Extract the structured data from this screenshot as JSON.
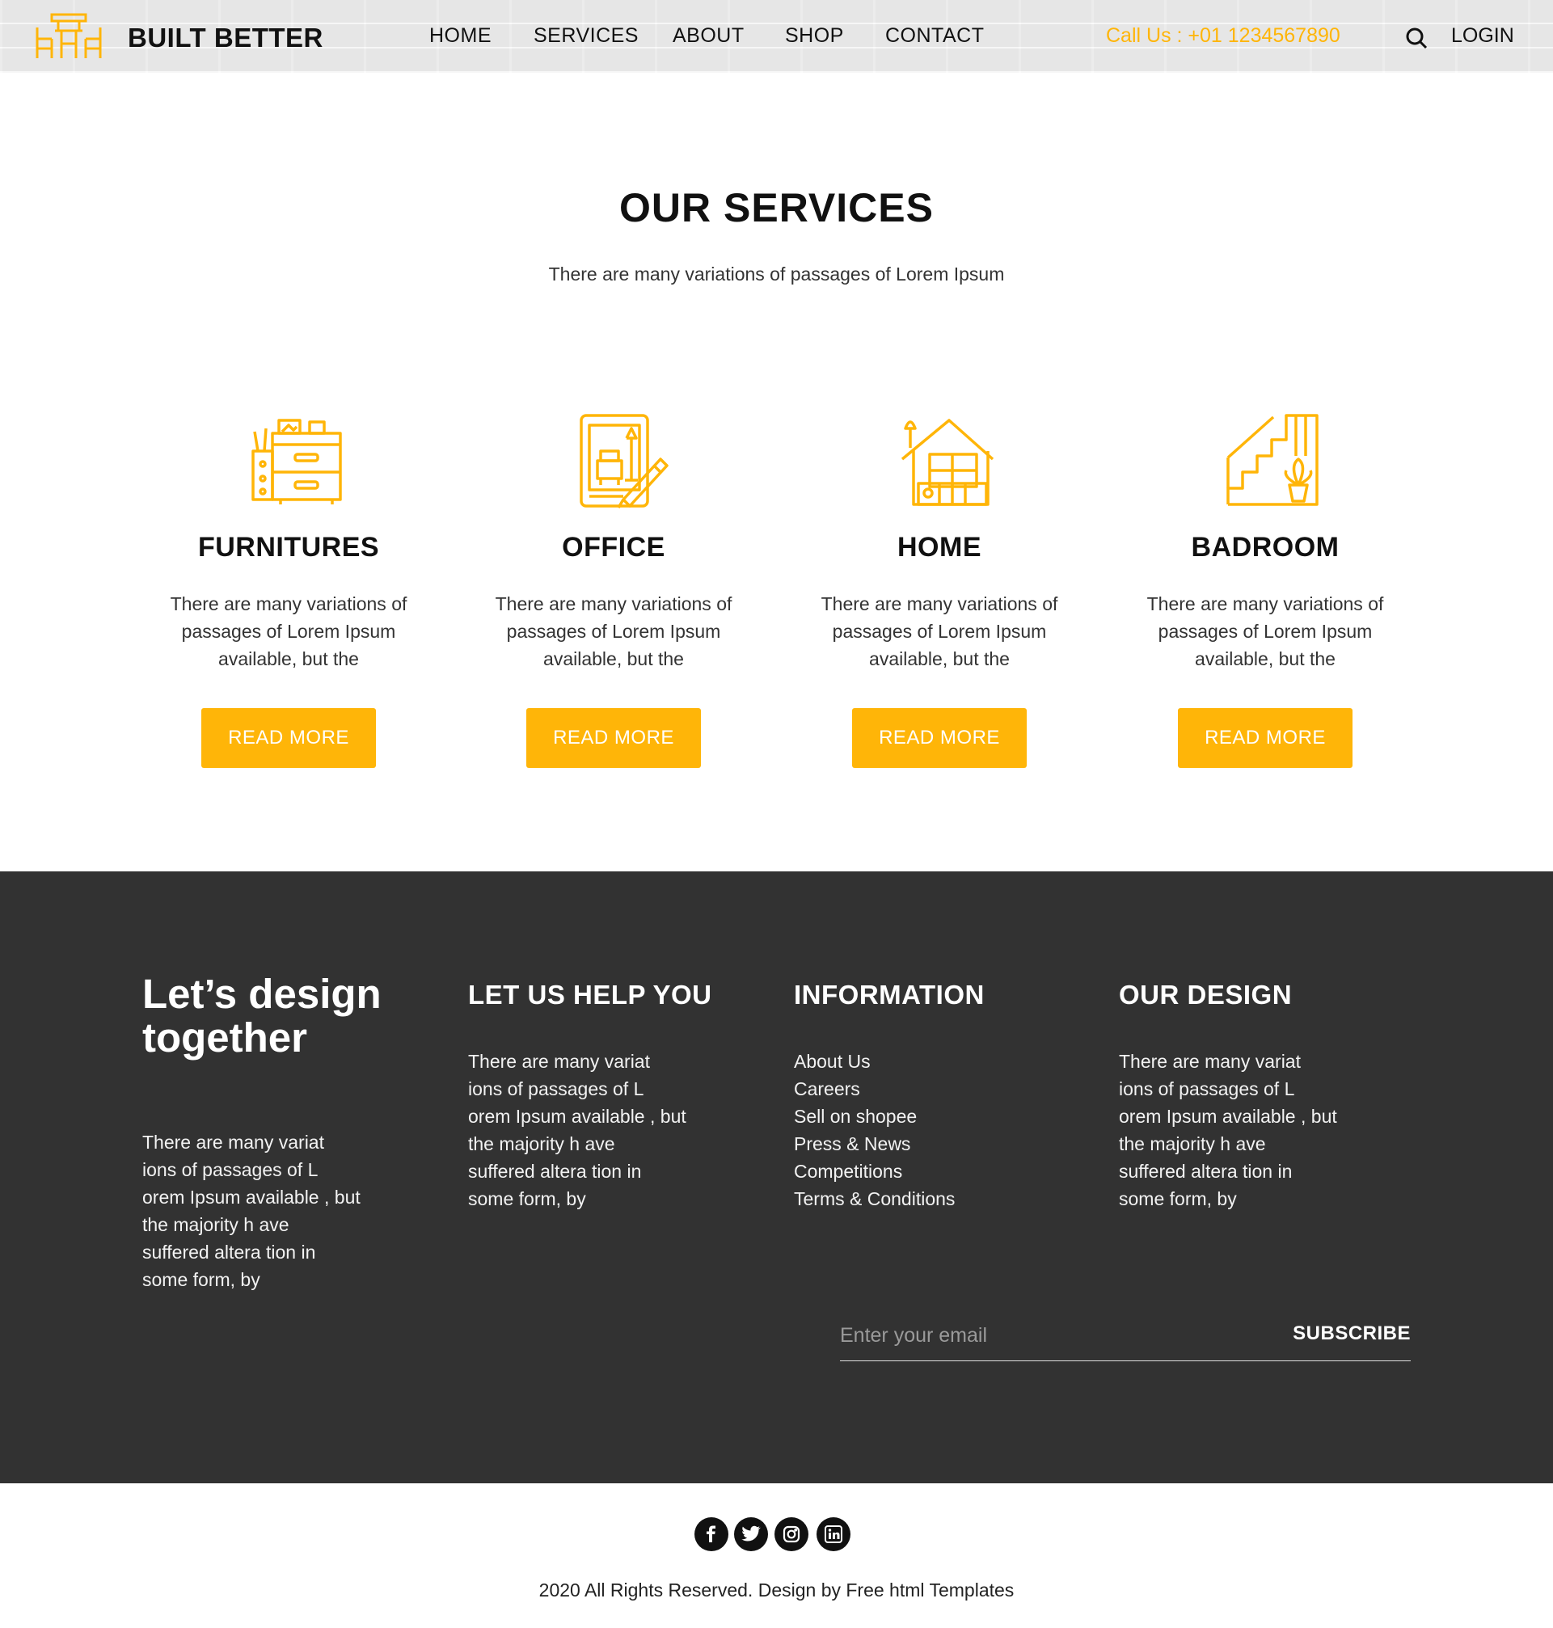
{
  "header": {
    "brand": "BUILT BETTER",
    "nav": [
      "HOME",
      "SERVICES",
      "ABOUT",
      "SHOP",
      "CONTACT"
    ],
    "call": "Call Us : +01 1234567890",
    "login": "LOGIN",
    "accent_color": "#ffb508"
  },
  "services": {
    "title": "OUR SERVICES",
    "subtitle": "There are many variations of passages of Lorem Ipsum",
    "cards": [
      {
        "title": "FURNITURES",
        "text": "There are many variations of passages of Lorem Ipsum available, but the",
        "button": "READ MORE",
        "icon": "furniture-icon"
      },
      {
        "title": "OFFICE",
        "text": "There are many variations of passages of Lorem Ipsum available, but the",
        "button": "READ MORE",
        "icon": "office-design-icon"
      },
      {
        "title": "HOME",
        "text": "There are many variations of passages of Lorem Ipsum available, but the",
        "button": "READ MORE",
        "icon": "home-icon"
      },
      {
        "title": "BADROOM",
        "text": "There are many variations of passages of Lorem Ipsum available, but the",
        "button": "READ MORE",
        "icon": "stairs-plant-icon"
      }
    ]
  },
  "footer": {
    "slogan": "Let’s design together",
    "slogan_text": "There are many variat ions of passages of L orem Ipsum available , but the majority h ave suffered altera tion in some form, by",
    "help_title": "LET US HELP YOU",
    "help_text": "There are many variat ions of passages of L orem Ipsum available , but the majority h ave suffered altera tion in some form, by",
    "info_title": "INFORMATION",
    "info_links": [
      "About Us",
      "Careers",
      "Sell on shopee",
      "Press & News",
      "Competitions",
      "Terms & Conditions"
    ],
    "design_title": "OUR DESIGN",
    "design_text": "There are many variat ions of passages of L orem Ipsum available , but the majority h ave suffered altera tion in some form, by",
    "email_placeholder": "Enter your email",
    "subscribe": "SUBSCRIBE",
    "background": "#323232"
  },
  "bottom": {
    "social_icons": [
      "facebook-icon",
      "twitter-icon",
      "instagram-icon",
      "linkedin-icon"
    ],
    "copyright": "2020 All Rights Reserved. Design by Free html Templates"
  }
}
